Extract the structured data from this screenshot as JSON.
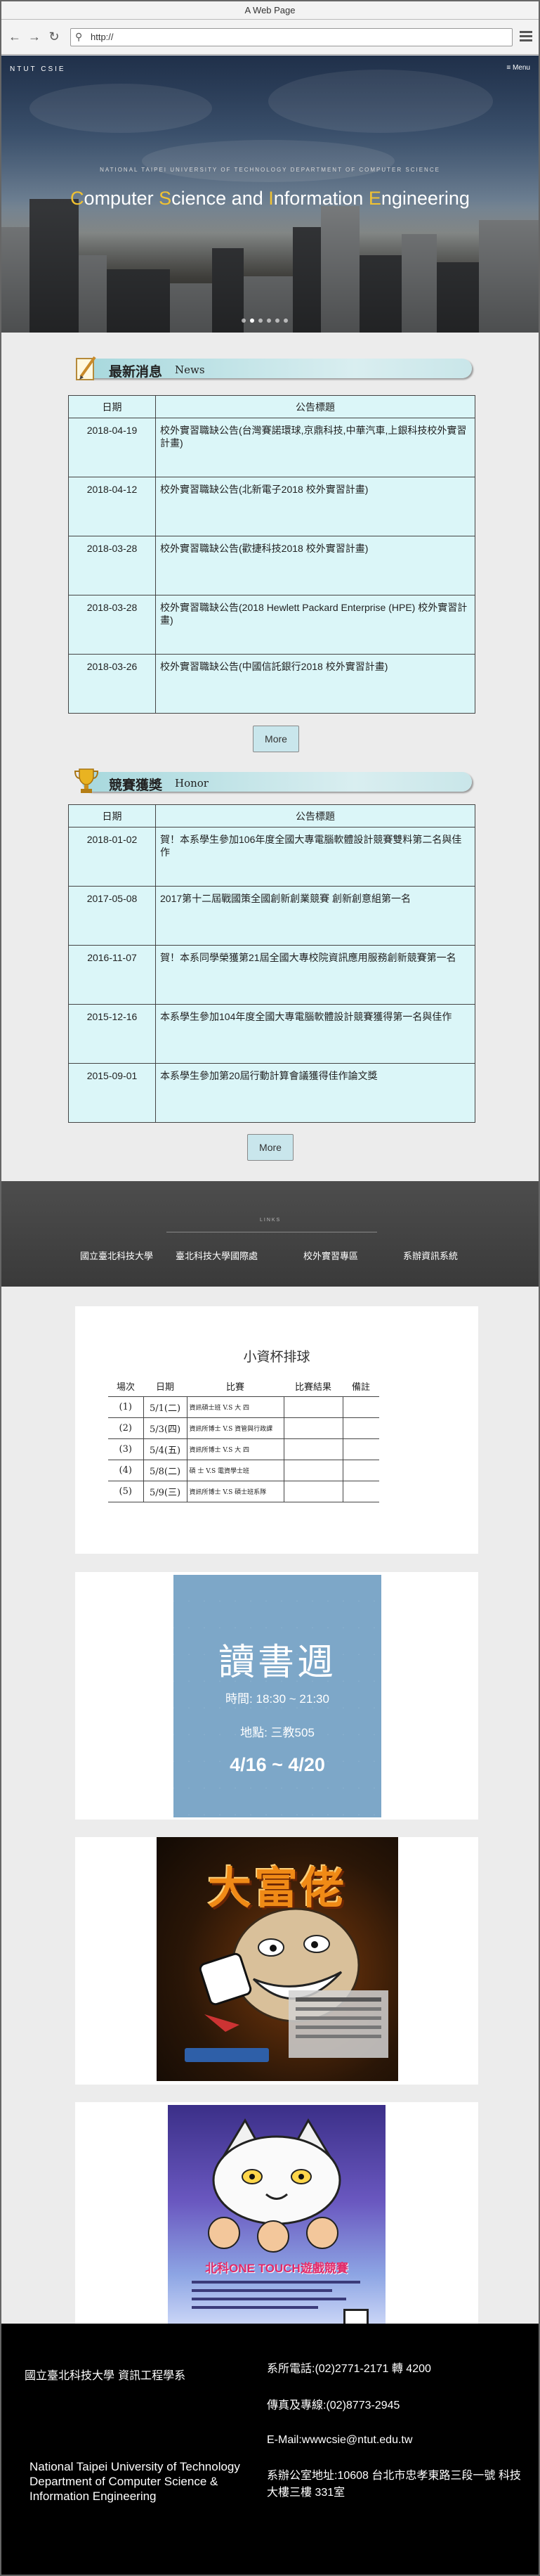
{
  "browser": {
    "title": "A Web Page",
    "url": "http://"
  },
  "hero": {
    "logo": "NTUT CSIE",
    "menu_label": "≡ Menu",
    "subtitle": "NATIONAL TAIPEI UNIVERSITY OF TECHNOLOGY DEPARTMENT OF COMPUTER SCIENCE",
    "title_parts": [
      {
        "cap": "C",
        "rest": "omputer "
      },
      {
        "cap": "S",
        "rest": "cience and "
      },
      {
        "cap": "I",
        "rest": "nformation "
      },
      {
        "cap": "E",
        "rest": "ngineering"
      }
    ],
    "slide_count": 6,
    "active_slide": 1
  },
  "news": {
    "title": "最新消息",
    "title_en": "News",
    "col_date": "日期",
    "col_title": "公告標題",
    "more": "More",
    "rows": [
      {
        "date": "2018-04-19",
        "title": "校外實習職缺公告(台灣賽諾環球,京鼎科技,中華汽車,上銀科技校外實習計畫)"
      },
      {
        "date": "2018-04-12",
        "title": "校外實習職缺公告(北新電子2018 校外實習計畫)"
      },
      {
        "date": "2018-03-28",
        "title": "校外實習職缺公告(歡捷科技2018 校外實習計畫)"
      },
      {
        "date": "2018-03-28",
        "title": "校外實習職缺公告(2018 Hewlett Packard Enterprise (HPE) 校外實習計畫)"
      },
      {
        "date": "2018-03-26",
        "title": "校外實習職缺公告(中國信託銀行2018 校外實習計畫)"
      }
    ]
  },
  "honor": {
    "title": "競賽獲獎",
    "title_en": "Honor",
    "col_date": "日期",
    "col_title": "公告標題",
    "more": "More",
    "rows": [
      {
        "date": "2018-01-02",
        "title": "賀！本系學生參加106年度全國大專電腦軟體設計競賽雙料第二名與佳作"
      },
      {
        "date": "2017-05-08",
        "title": "2017第十二屆戰國策全國創新創業競賽 創新創意組第一名"
      },
      {
        "date": "2016-11-07",
        "title": "賀！本系同學榮獲第21屆全國大專校院資訊應用服務創新競賽第一名"
      },
      {
        "date": "2015-12-16",
        "title": "本系學生參加104年度全國大專電腦軟體設計競賽獲得第一名與佳作"
      },
      {
        "date": "2015-09-01",
        "title": "本系學生參加第20屆行動計算會議獲得佳作論文獎"
      }
    ]
  },
  "links": {
    "band_title": "LINKS",
    "items": [
      "國立臺北科技大學",
      "臺北科技大學國際處",
      "校外實習專區",
      "系辦資訊系統"
    ]
  },
  "schedule": {
    "title": "小資杯排球",
    "headers": [
      "場次",
      "日期",
      "比賽",
      "比賽結果",
      "備註"
    ],
    "rows": [
      {
        "no": "(1)",
        "date": "5/1(二)",
        "match": "資訊碩士班 V.S  大    四"
      },
      {
        "no": "(2)",
        "date": "5/3(四)",
        "match": "資訊所博士 V.S  資管與行政課"
      },
      {
        "no": "(3)",
        "date": "5/4(五)",
        "match": "資訊所博士 V.S  大    四"
      },
      {
        "no": "(4)",
        "date": "5/8(二)",
        "match": "碩    士 V.S  電資學士班"
      },
      {
        "no": "(5)",
        "date": "5/9(三)",
        "match": "資訊所博士 V.S  碩士班系隊"
      }
    ]
  },
  "reading_week": {
    "title": "讀書週",
    "time": "時間: 18:30 ~ 21:30",
    "place": "地點: 三教505",
    "dates": "4/16 ~ 4/20"
  },
  "rich_poster": {
    "title": "大富佬"
  },
  "game_poster": {
    "title": "北科ONE TOUCH遊戲競賽"
  },
  "footer": {
    "name_cn": "國立臺北科技大學 資訊工程學系",
    "name_en": "National Taipei University of Technology Department of Computer Science & Information Engineering",
    "phone": "系所電話:(02)2771-2171 轉 4200",
    "fax": "傳真及專線:(02)8773-2945",
    "email": "E-Mail:wwwcsie@ntut.edu.tw",
    "address": "系辦公室地址:10608 台北市忠孝東路三段一號 科技大樓三樓 331室"
  }
}
